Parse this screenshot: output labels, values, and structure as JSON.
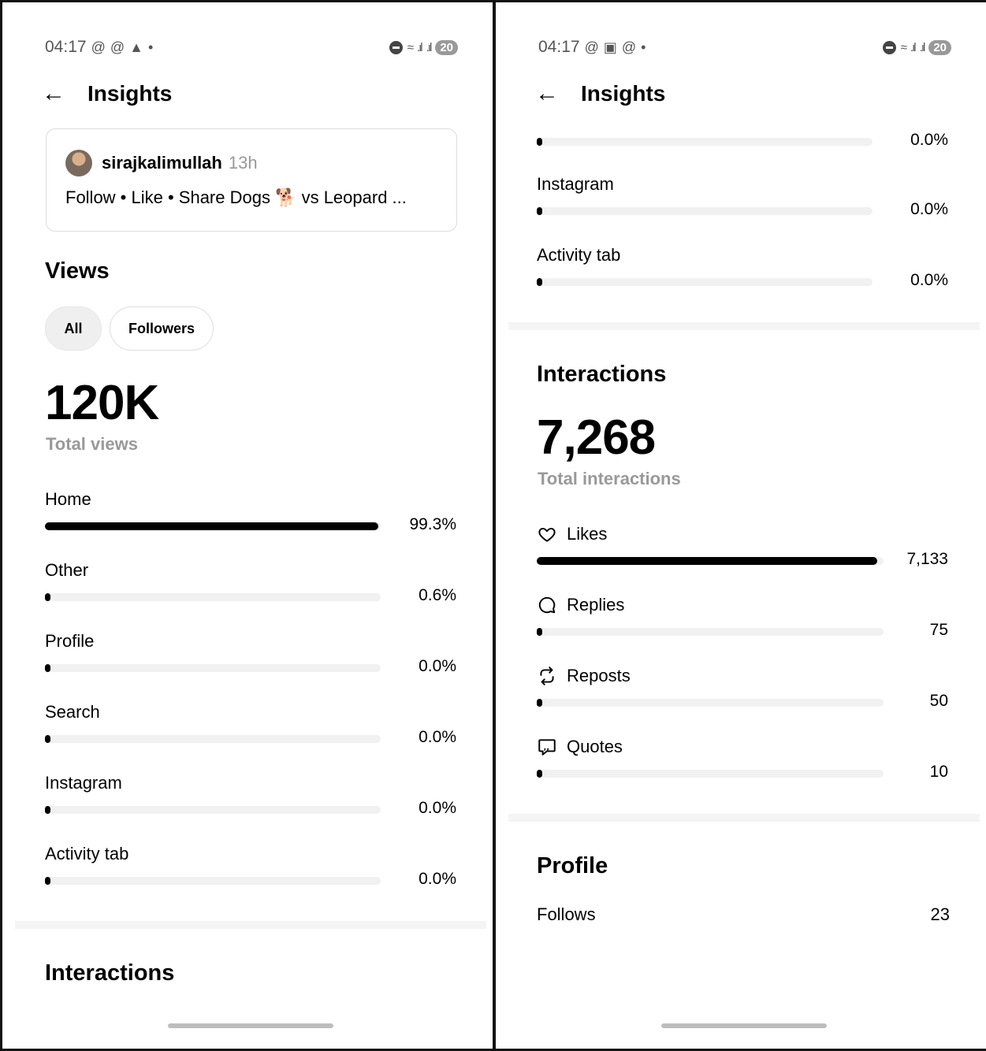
{
  "status_bar": {
    "time": "04:17",
    "battery": "20"
  },
  "header": {
    "title": "Insights"
  },
  "post": {
    "username": "sirajkalimullah",
    "age": "13h",
    "text": "Follow • Like • Share Dogs 🐕 vs Leopard ..."
  },
  "views": {
    "title": "Views",
    "filters": [
      {
        "label": "All",
        "selected": true
      },
      {
        "label": "Followers",
        "selected": false
      }
    ],
    "total": "120K",
    "total_label": "Total views",
    "sources": [
      {
        "label": "Home",
        "value": "99.3%",
        "fraction": 0.993
      },
      {
        "label": "Other",
        "value": "0.6%",
        "fraction": 0.006
      },
      {
        "label": "Profile",
        "value": "0.0%",
        "fraction": 0.0
      },
      {
        "label": "Search",
        "value": "0.0%",
        "fraction": 0.0
      },
      {
        "label": "Instagram",
        "value": "0.0%",
        "fraction": 0.0
      },
      {
        "label": "Activity tab",
        "value": "0.0%",
        "fraction": 0.0
      }
    ],
    "top_value": "0.0%"
  },
  "interactions": {
    "title": "Interactions",
    "total": "7,268",
    "total_label": "Total interactions",
    "items": [
      {
        "label": "Likes",
        "icon": "heart-icon",
        "value": "7,133",
        "fraction": 0.981
      },
      {
        "label": "Replies",
        "icon": "reply-icon",
        "value": "75",
        "fraction": 0.01
      },
      {
        "label": "Reposts",
        "icon": "repost-icon",
        "value": "50",
        "fraction": 0.007
      },
      {
        "label": "Quotes",
        "icon": "quote-icon",
        "value": "10",
        "fraction": 0.001
      }
    ]
  },
  "profile": {
    "title": "Profile",
    "follows_label": "Follows",
    "follows_value": "23"
  }
}
